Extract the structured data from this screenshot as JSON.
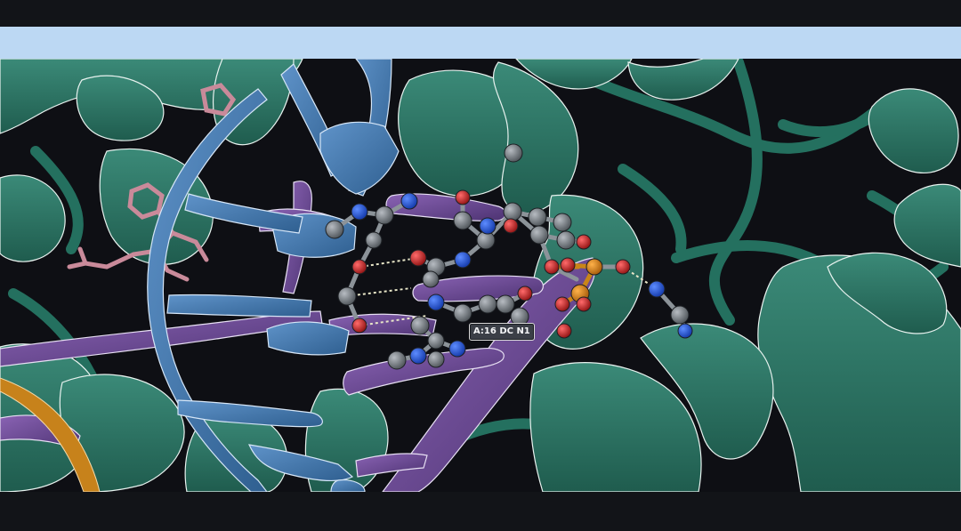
{
  "viewer": {
    "hover_label": "A:16 DC N1"
  }
}
